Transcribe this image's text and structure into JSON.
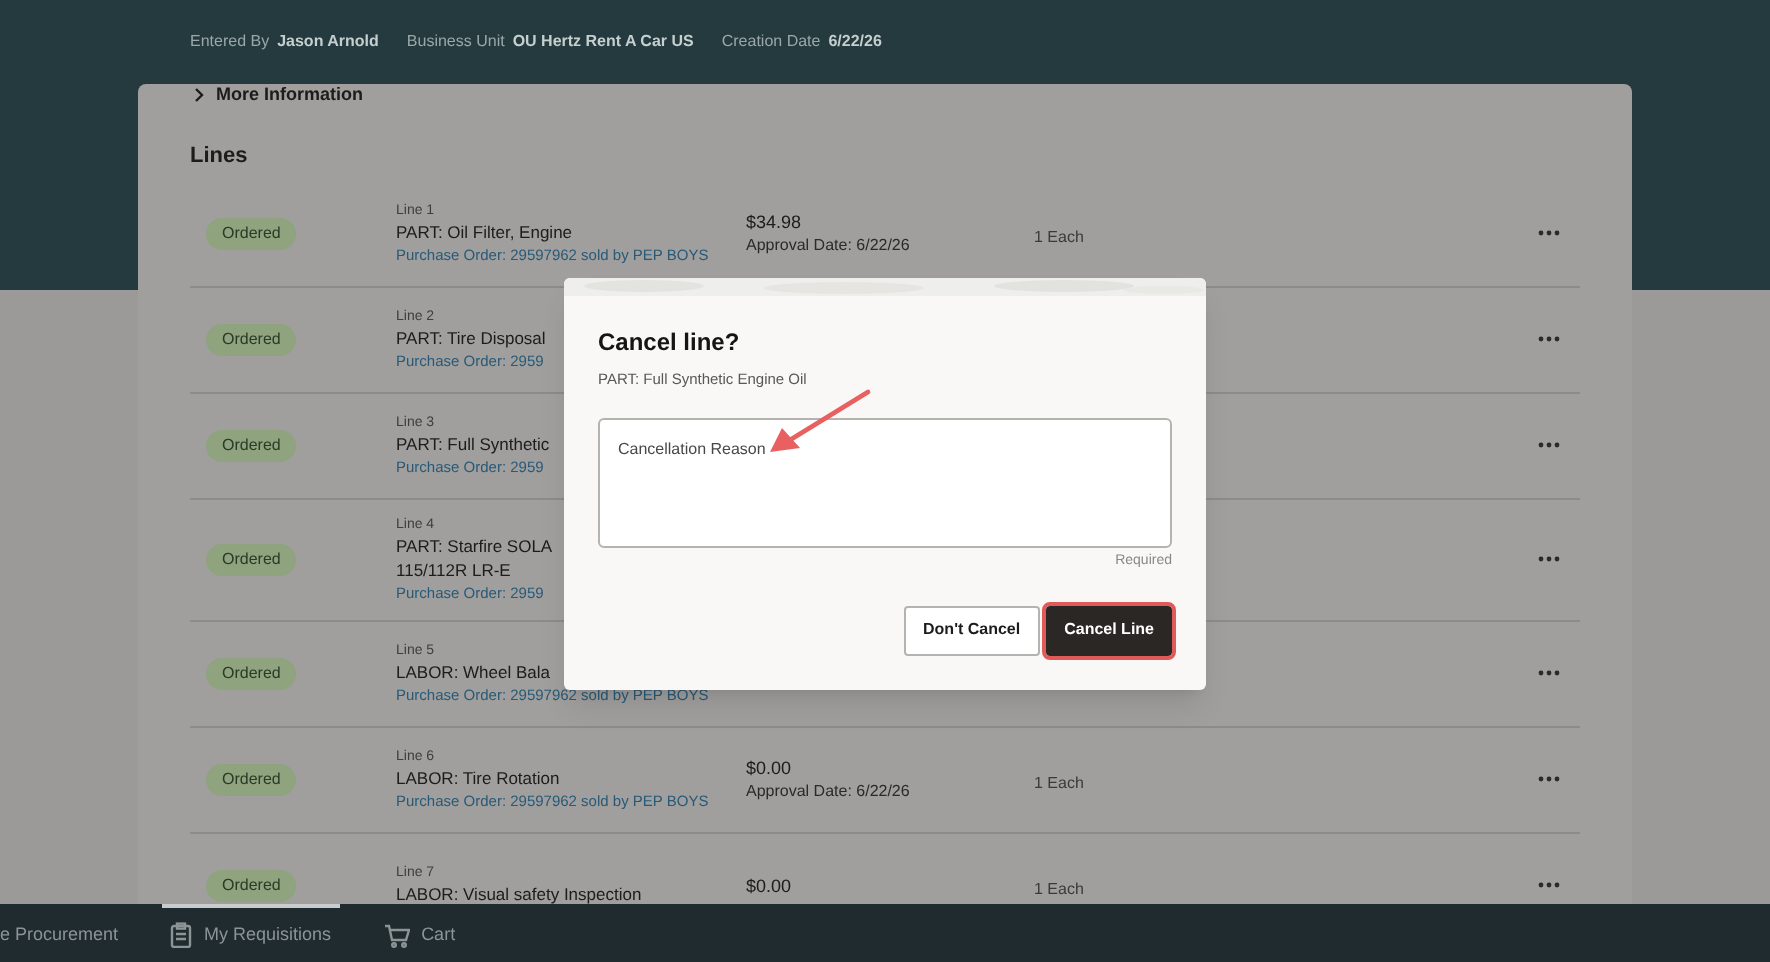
{
  "header": {
    "fields": [
      {
        "label": "Entered By",
        "value": "Jason Arnold"
      },
      {
        "label": "Business Unit",
        "value": "OU Hertz Rent A Car US"
      },
      {
        "label": "Creation Date",
        "value": "6/22/26"
      }
    ]
  },
  "more_information": {
    "label": "More Information",
    "expanded": false
  },
  "lines": {
    "title": "Lines",
    "rows": [
      {
        "status": "Ordered",
        "line": "Line 1",
        "title": [
          "PART: Oil Filter, Engine"
        ],
        "po": "Purchase Order: 29597962 sold by PEP BOYS",
        "price": "$34.98",
        "approval": "Approval Date: 6/22/26",
        "quantity": "1 Each"
      },
      {
        "status": "Ordered",
        "line": "Line 2",
        "title": [
          "PART: Tire Disposal"
        ],
        "po": "Purchase Order: 2959"
      },
      {
        "status": "Ordered",
        "line": "Line 3",
        "title": [
          "PART: Full Synthetic"
        ],
        "po": "Purchase Order: 2959"
      },
      {
        "status": "Ordered",
        "line": "Line 4",
        "title": [
          "PART: Starfire SOLA",
          "115/112R LR-E"
        ],
        "po": "Purchase Order: 2959"
      },
      {
        "status": "Ordered",
        "line": "Line 5",
        "title": [
          "LABOR: Wheel Bala"
        ],
        "po": "Purchase Order: 29597962 sold by PEP BOYS"
      },
      {
        "status": "Ordered",
        "line": "Line 6",
        "title": [
          "LABOR: Tire Rotation"
        ],
        "po": "Purchase Order: 29597962 sold by PEP BOYS",
        "price": "$0.00",
        "approval": "Approval Date: 6/22/26",
        "quantity": "1 Each"
      },
      {
        "status": "Ordered",
        "line": "Line 7",
        "title": [
          "LABOR: Visual safety Inspection"
        ],
        "price": "$0.00",
        "quantity": "1 Each"
      }
    ]
  },
  "dialog": {
    "title": "Cancel line?",
    "subtitle": "PART: Full Synthetic Engine Oil",
    "reason_placeholder": "Cancellation Reason",
    "hint": "Required",
    "buttons": [
      {
        "label": "Don't Cancel",
        "kind": "secondary"
      },
      {
        "label": "Cancel Line",
        "kind": "primary"
      }
    ]
  },
  "bottom_nav": [
    {
      "label": "e Procurement",
      "selected": false
    },
    {
      "label": "My Requisitions",
      "selected": true
    },
    {
      "label": "Cart",
      "selected": false
    }
  ]
}
